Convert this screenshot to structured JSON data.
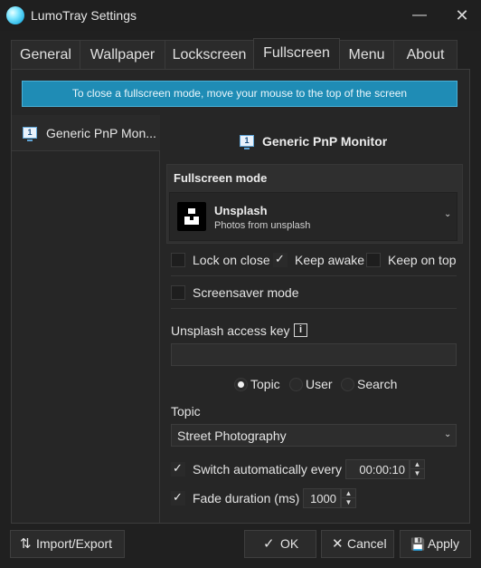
{
  "window": {
    "title": "LumoTray Settings",
    "minimize_icon": "—",
    "close_icon": "✕"
  },
  "tabs": [
    {
      "label": "General"
    },
    {
      "label": "Wallpaper"
    },
    {
      "label": "Lockscreen"
    },
    {
      "label": "Fullscreen",
      "active": true
    },
    {
      "label": "Menu"
    },
    {
      "label": "About"
    }
  ],
  "banner": "To close a fullscreen mode, move your mouse to the top of the screen",
  "monitors": [
    {
      "label": "Generic PnP Mon...",
      "number": "1"
    }
  ],
  "monitor_heading": "Generic PnP Monitor",
  "fullscreen_mode": {
    "label": "Fullscreen mode",
    "selected_title": "Unsplash",
    "selected_subtitle": "Photos from unsplash"
  },
  "options": {
    "lock_on_close": {
      "label": "Lock on close",
      "checked": false
    },
    "keep_awake": {
      "label": "Keep awake",
      "checked": true
    },
    "keep_on_top": {
      "label": "Keep on top",
      "checked": false
    },
    "screensaver_mode": {
      "label": "Screensaver mode",
      "checked": false
    }
  },
  "access_key": {
    "label": "Unsplash access key",
    "info_glyph": "i",
    "value": ""
  },
  "source_radio": {
    "options": [
      "Topic",
      "User",
      "Search"
    ],
    "selected": "Topic"
  },
  "topic": {
    "label": "Topic",
    "value": "Street Photography"
  },
  "switch_auto": {
    "label": "Switch automatically every",
    "checked": true,
    "value": "00:00:10"
  },
  "fade": {
    "label": "Fade duration (ms)",
    "checked": true,
    "value": "1000"
  },
  "footer": {
    "import_export": "Import/Export",
    "ok": "OK",
    "cancel": "Cancel",
    "apply": "Apply"
  },
  "glyphs": {
    "check": "✓",
    "chevron_down": "⌄",
    "spin_up": "▲",
    "spin_down": "▼",
    "import_export_icon": "⇅",
    "ok_icon": "✓",
    "cancel_icon": "✕",
    "apply_icon": "💾"
  },
  "colors": {
    "accent": "#1f8cb5",
    "background": "#202020",
    "panel": "#262626"
  }
}
